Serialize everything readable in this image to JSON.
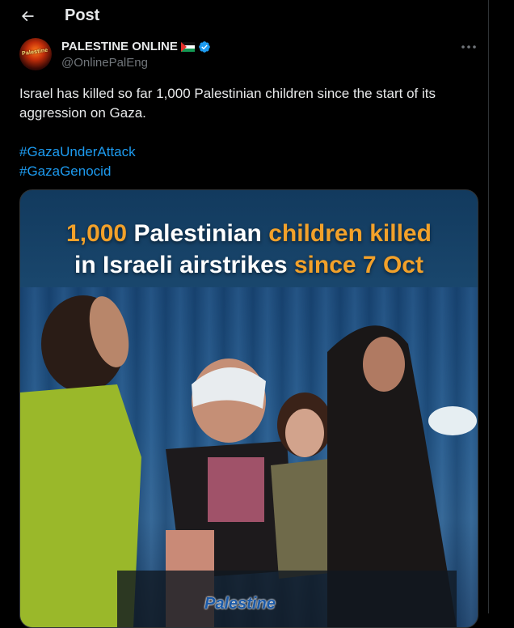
{
  "header": {
    "title": "Post",
    "back_icon": "arrow-left-icon"
  },
  "author": {
    "avatar_text": "Palestine",
    "display_name": "PALESTINE ONLINE",
    "handle": "@OnlinePalEng",
    "flag_icon": "palestine-flag-icon",
    "verified_icon": "verified-badge-icon",
    "verified_color": "#1d9bf0"
  },
  "more_icon": "more-options-icon",
  "tweet": {
    "text": "Israel has killed so far 1,000 Palestinian children since the start of its aggression on Gaza.",
    "hashtags": [
      "#GazaUnderAttack",
      "#GazaGenocid"
    ]
  },
  "media": {
    "headline_line1_part1": "1,000",
    "headline_line1_part2": " Palestinian ",
    "headline_line1_part3": "children killed",
    "headline_line2_part1": "in Israeli airstrikes ",
    "headline_line2_part2": "since 7 Oct",
    "watermark": "Palestine",
    "accent_color": "#f2a12a"
  }
}
